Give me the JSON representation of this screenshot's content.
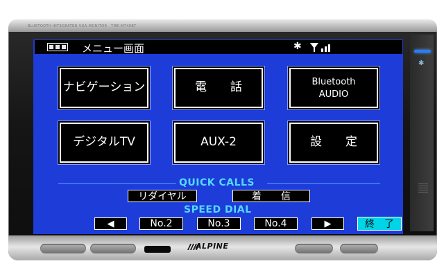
{
  "device": {
    "model_left": "BLUETOOTH INTEGRATED VGA MONITOR",
    "model_right": "TME-M740BT",
    "brand": "ALPINE"
  },
  "header": {
    "title": "メニュー画面",
    "bluetooth_icon": "bluetooth-icon",
    "signal_icon": "signal-icon"
  },
  "tiles": [
    {
      "label": "ナビゲーション"
    },
    {
      "label": "電　　話"
    },
    {
      "line1": "Bluetooth",
      "line2": "AUDIO"
    },
    {
      "label": "デジタルTV"
    },
    {
      "label": "AUX-2"
    },
    {
      "label": "設　　定"
    }
  ],
  "quick_calls": {
    "label": "QUICK CALLS",
    "redial": "リダイヤル",
    "incoming": "着　　信"
  },
  "speed_dial": {
    "label": "SPEED DIAL",
    "prev_icon": "left-triangle-icon",
    "slots": [
      "No.2",
      "No.3",
      "No.4"
    ],
    "next_icon": "right-triangle-icon",
    "exit": "終　了"
  },
  "colors": {
    "screen_bg": "#1d3cd8",
    "section_label": "#55d8ff",
    "exit_bg": "#00d5e8"
  }
}
